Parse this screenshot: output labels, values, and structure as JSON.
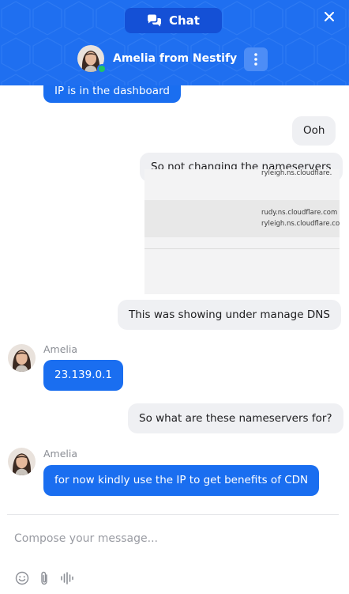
{
  "header": {
    "tab_label": "Chat",
    "agent_name": "Amelia from Nestify",
    "accent_color": "#1f6ff0",
    "icons": [
      "chat-bubbles-icon",
      "close-icon",
      "more-vertical-icon"
    ]
  },
  "messages": {
    "partial_agent": "IP is in the dashboard",
    "user_1": "Ooh",
    "user_2": "So not changing the nameservers",
    "screenshot_lines": [
      "ryleigh.ns.cloudflare.",
      "rudy.ns.cloudflare.com",
      "ryleigh.ns.cloudflare.com"
    ],
    "user_3": "This was showing under manage DNS",
    "sender_1": "Amelia",
    "agent_1": "23.139.0.1",
    "user_4": "So what are these nameservers for?",
    "sender_2": "Amelia",
    "agent_2": "for now kindly use the IP to get benefits of CDN"
  },
  "composer": {
    "placeholder": "Compose your message...",
    "tools": [
      "emoji-icon",
      "attachment-icon",
      "voice-icon"
    ]
  }
}
